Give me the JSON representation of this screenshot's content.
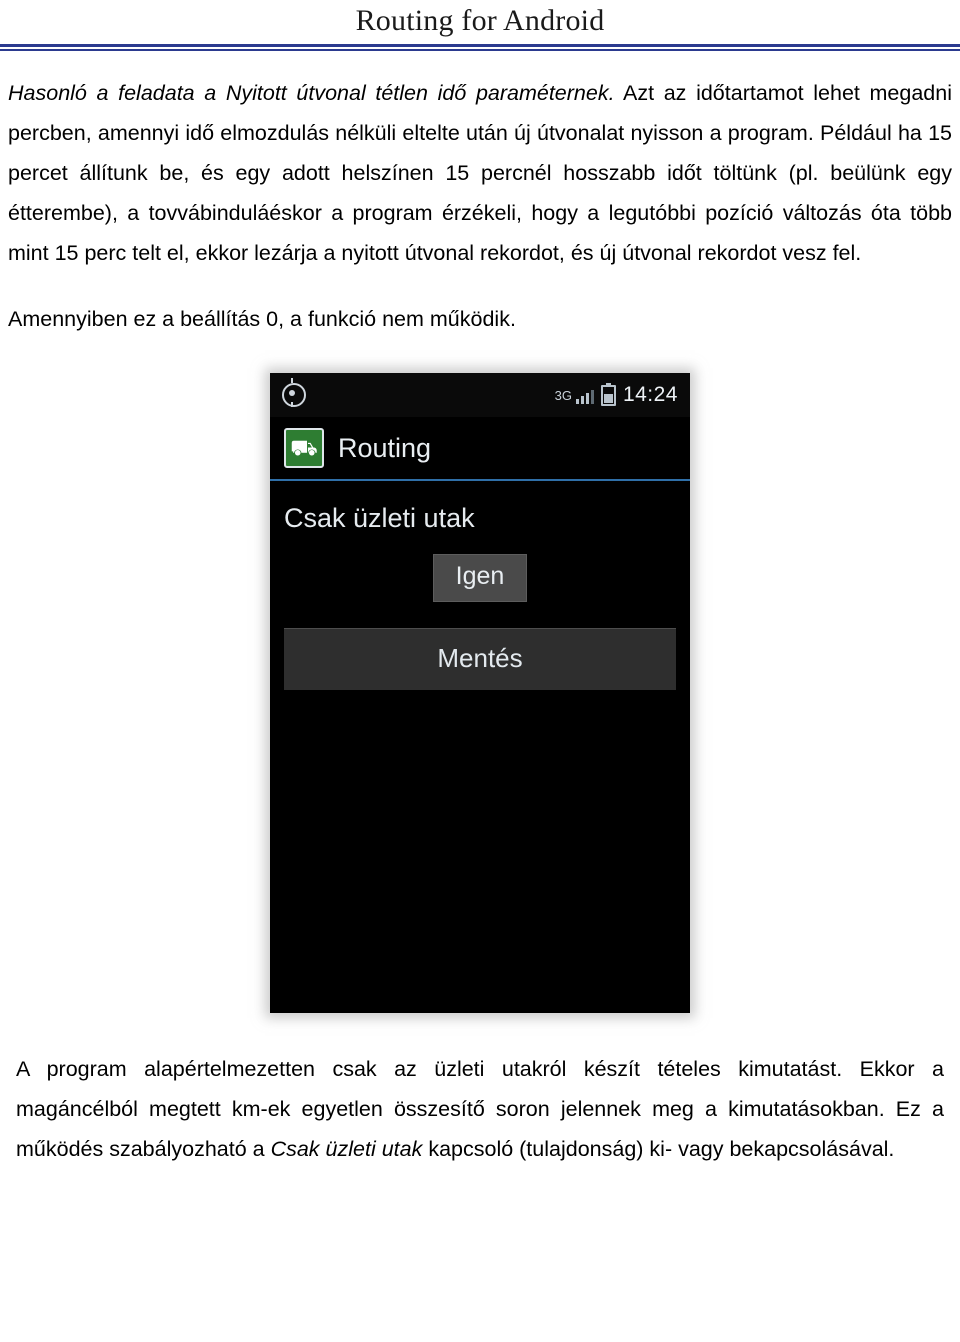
{
  "header": {
    "title": "Routing for Android"
  },
  "body": {
    "paragraph_1_parts": {
      "lead_italic": "Hasonló a feladata a Nyitott útvonal tétlen idő paraméternek.",
      "rest": " Azt az időtartamot lehet megadni percben, amennyi idő elmozdulás nélküli eltelte után új útvonalat nyisson a program. Például ha 15 percet állítunk be, és egy adott helszínen 15 percnél hosszabb időt töltünk (pl. beülünk egy étterembe), a tovvábinduláéskor a program érzékeli, hogy a legutóbbi pozíció változás óta több mint 15 perc telt el, ekkor lezárja a nyitott útvonal rekordot, és új útvonal rekordot vesz fel."
    },
    "paragraph_2": "Amennyiben ez a beállítás 0, a funkció nem működik."
  },
  "screenshot": {
    "status_bar": {
      "gps_icon": "gps-icon",
      "network_label": "3G",
      "signal_icon": "signal-icon",
      "battery_icon": "battery-icon",
      "clock": "14:24"
    },
    "app_bar": {
      "icon": "routing-app-icon",
      "icon_glyph": "⛟",
      "title": "Routing"
    },
    "setting_label": "Csak üzleti utak",
    "toggle_value": "Igen",
    "save_button": "Mentés"
  },
  "footer": {
    "text_part_1": "A program alapértelmezetten csak az üzleti utakról készít tételes kimutatást. Ekkor a magáncélból megtett km-ek egyetlen összesítő soron jelennek meg a kimutatásokban. Ez a működés szabályozható a ",
    "italic_part": "Csak üzleti utak",
    "text_part_2": " kapcsoló (tulajdonság) ki- vagy bekapcsolásával."
  }
}
